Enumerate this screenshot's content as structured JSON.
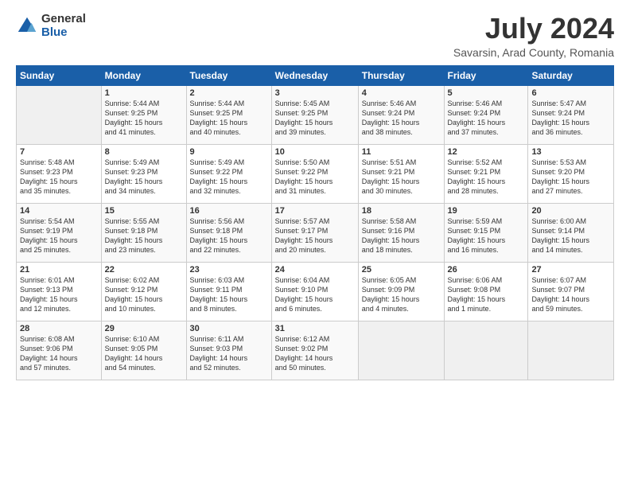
{
  "logo": {
    "general": "General",
    "blue": "Blue"
  },
  "title": "July 2024",
  "subtitle": "Savarsin, Arad County, Romania",
  "headers": [
    "Sunday",
    "Monday",
    "Tuesday",
    "Wednesday",
    "Thursday",
    "Friday",
    "Saturday"
  ],
  "weeks": [
    [
      {
        "day": "",
        "info": ""
      },
      {
        "day": "1",
        "info": "Sunrise: 5:44 AM\nSunset: 9:25 PM\nDaylight: 15 hours\nand 41 minutes."
      },
      {
        "day": "2",
        "info": "Sunrise: 5:44 AM\nSunset: 9:25 PM\nDaylight: 15 hours\nand 40 minutes."
      },
      {
        "day": "3",
        "info": "Sunrise: 5:45 AM\nSunset: 9:25 PM\nDaylight: 15 hours\nand 39 minutes."
      },
      {
        "day": "4",
        "info": "Sunrise: 5:46 AM\nSunset: 9:24 PM\nDaylight: 15 hours\nand 38 minutes."
      },
      {
        "day": "5",
        "info": "Sunrise: 5:46 AM\nSunset: 9:24 PM\nDaylight: 15 hours\nand 37 minutes."
      },
      {
        "day": "6",
        "info": "Sunrise: 5:47 AM\nSunset: 9:24 PM\nDaylight: 15 hours\nand 36 minutes."
      }
    ],
    [
      {
        "day": "7",
        "info": "Sunrise: 5:48 AM\nSunset: 9:23 PM\nDaylight: 15 hours\nand 35 minutes."
      },
      {
        "day": "8",
        "info": "Sunrise: 5:49 AM\nSunset: 9:23 PM\nDaylight: 15 hours\nand 34 minutes."
      },
      {
        "day": "9",
        "info": "Sunrise: 5:49 AM\nSunset: 9:22 PM\nDaylight: 15 hours\nand 32 minutes."
      },
      {
        "day": "10",
        "info": "Sunrise: 5:50 AM\nSunset: 9:22 PM\nDaylight: 15 hours\nand 31 minutes."
      },
      {
        "day": "11",
        "info": "Sunrise: 5:51 AM\nSunset: 9:21 PM\nDaylight: 15 hours\nand 30 minutes."
      },
      {
        "day": "12",
        "info": "Sunrise: 5:52 AM\nSunset: 9:21 PM\nDaylight: 15 hours\nand 28 minutes."
      },
      {
        "day": "13",
        "info": "Sunrise: 5:53 AM\nSunset: 9:20 PM\nDaylight: 15 hours\nand 27 minutes."
      }
    ],
    [
      {
        "day": "14",
        "info": "Sunrise: 5:54 AM\nSunset: 9:19 PM\nDaylight: 15 hours\nand 25 minutes."
      },
      {
        "day": "15",
        "info": "Sunrise: 5:55 AM\nSunset: 9:18 PM\nDaylight: 15 hours\nand 23 minutes."
      },
      {
        "day": "16",
        "info": "Sunrise: 5:56 AM\nSunset: 9:18 PM\nDaylight: 15 hours\nand 22 minutes."
      },
      {
        "day": "17",
        "info": "Sunrise: 5:57 AM\nSunset: 9:17 PM\nDaylight: 15 hours\nand 20 minutes."
      },
      {
        "day": "18",
        "info": "Sunrise: 5:58 AM\nSunset: 9:16 PM\nDaylight: 15 hours\nand 18 minutes."
      },
      {
        "day": "19",
        "info": "Sunrise: 5:59 AM\nSunset: 9:15 PM\nDaylight: 15 hours\nand 16 minutes."
      },
      {
        "day": "20",
        "info": "Sunrise: 6:00 AM\nSunset: 9:14 PM\nDaylight: 15 hours\nand 14 minutes."
      }
    ],
    [
      {
        "day": "21",
        "info": "Sunrise: 6:01 AM\nSunset: 9:13 PM\nDaylight: 15 hours\nand 12 minutes."
      },
      {
        "day": "22",
        "info": "Sunrise: 6:02 AM\nSunset: 9:12 PM\nDaylight: 15 hours\nand 10 minutes."
      },
      {
        "day": "23",
        "info": "Sunrise: 6:03 AM\nSunset: 9:11 PM\nDaylight: 15 hours\nand 8 minutes."
      },
      {
        "day": "24",
        "info": "Sunrise: 6:04 AM\nSunset: 9:10 PM\nDaylight: 15 hours\nand 6 minutes."
      },
      {
        "day": "25",
        "info": "Sunrise: 6:05 AM\nSunset: 9:09 PM\nDaylight: 15 hours\nand 4 minutes."
      },
      {
        "day": "26",
        "info": "Sunrise: 6:06 AM\nSunset: 9:08 PM\nDaylight: 15 hours\nand 1 minute."
      },
      {
        "day": "27",
        "info": "Sunrise: 6:07 AM\nSunset: 9:07 PM\nDaylight: 14 hours\nand 59 minutes."
      }
    ],
    [
      {
        "day": "28",
        "info": "Sunrise: 6:08 AM\nSunset: 9:06 PM\nDaylight: 14 hours\nand 57 minutes."
      },
      {
        "day": "29",
        "info": "Sunrise: 6:10 AM\nSunset: 9:05 PM\nDaylight: 14 hours\nand 54 minutes."
      },
      {
        "day": "30",
        "info": "Sunrise: 6:11 AM\nSunset: 9:03 PM\nDaylight: 14 hours\nand 52 minutes."
      },
      {
        "day": "31",
        "info": "Sunrise: 6:12 AM\nSunset: 9:02 PM\nDaylight: 14 hours\nand 50 minutes."
      },
      {
        "day": "",
        "info": ""
      },
      {
        "day": "",
        "info": ""
      },
      {
        "day": "",
        "info": ""
      }
    ]
  ]
}
